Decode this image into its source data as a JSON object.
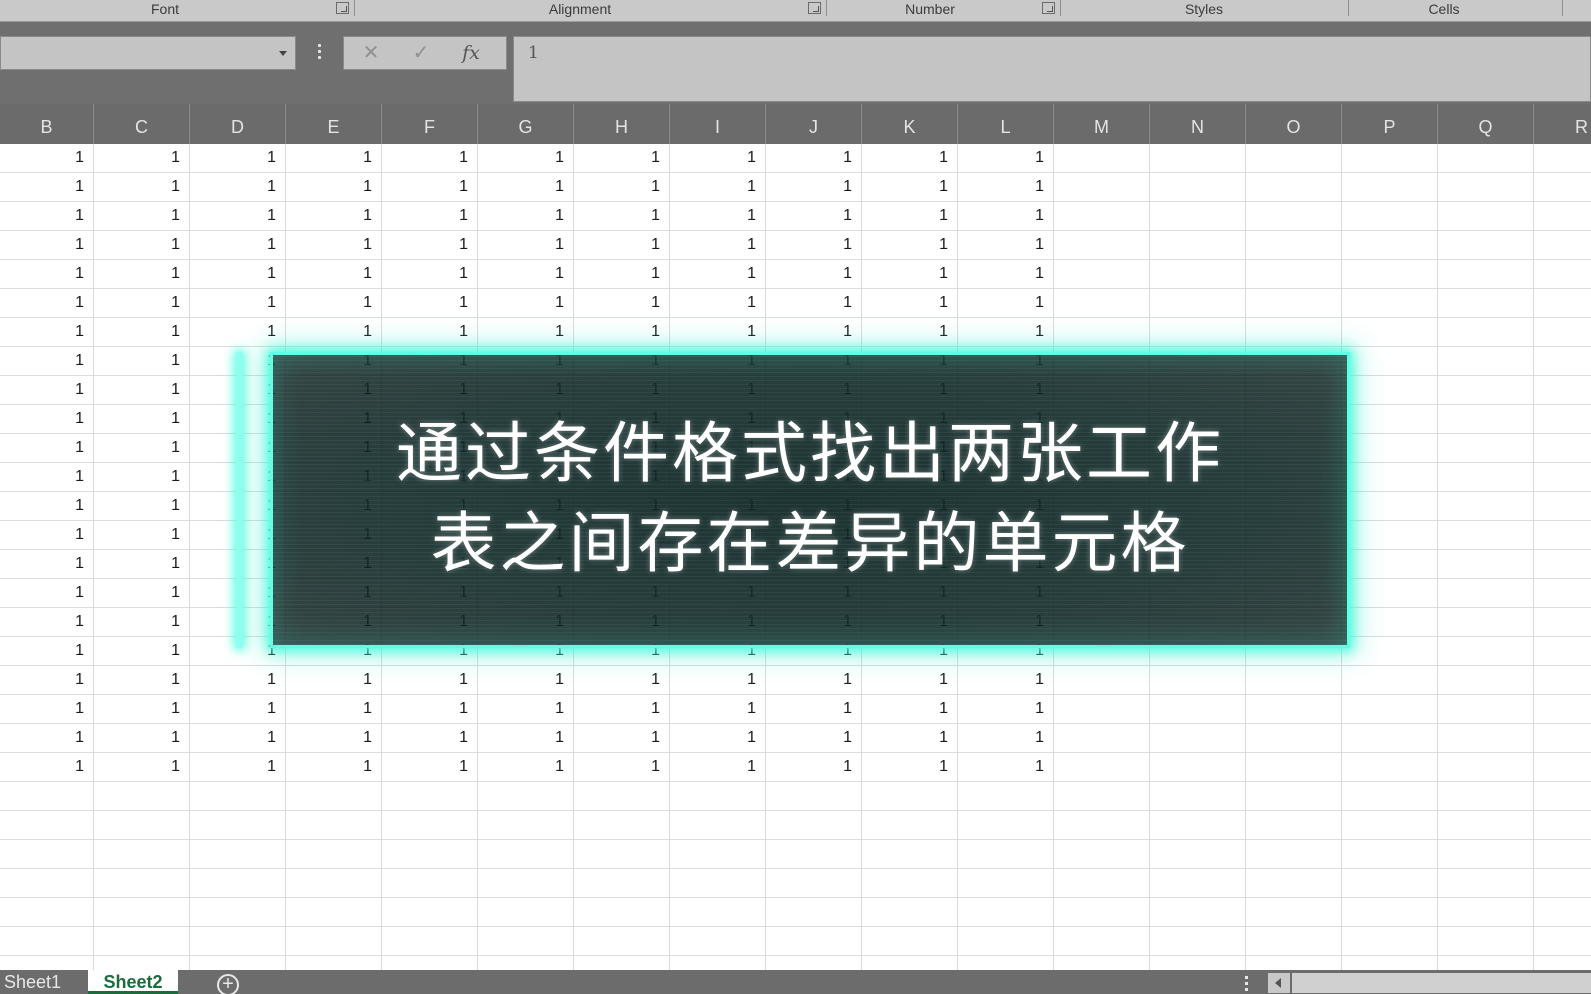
{
  "ribbon": {
    "groups": [
      "Font",
      "Alignment",
      "Number",
      "Styles",
      "Cells"
    ]
  },
  "formula_bar": {
    "name_box_value": "",
    "cancel_glyph": "✕",
    "enter_glyph": "✓",
    "fx_label": "fx",
    "formula_value": "1"
  },
  "columns": [
    "B",
    "C",
    "D",
    "E",
    "F",
    "G",
    "H",
    "I",
    "J",
    "K",
    "L",
    "M",
    "N",
    "O",
    "P",
    "Q",
    "R"
  ],
  "grid": {
    "filled_columns": [
      "B",
      "C",
      "D",
      "E",
      "F",
      "G",
      "H",
      "I",
      "J",
      "K",
      "L"
    ],
    "filled_row_count": 22,
    "cell_value": "1"
  },
  "overlay": {
    "line1": "通过条件格式找出两张工作",
    "line2": "表之间存在差异的单元格",
    "border_color": "#5fffe6"
  },
  "sheet_tabs": {
    "tabs": [
      "Sheet1",
      "Sheet2"
    ],
    "active": "Sheet2",
    "add_glyph": "+"
  },
  "colors": {
    "active_tab_text": "#1c6b3c",
    "header_bg": "#6b6b6b"
  }
}
